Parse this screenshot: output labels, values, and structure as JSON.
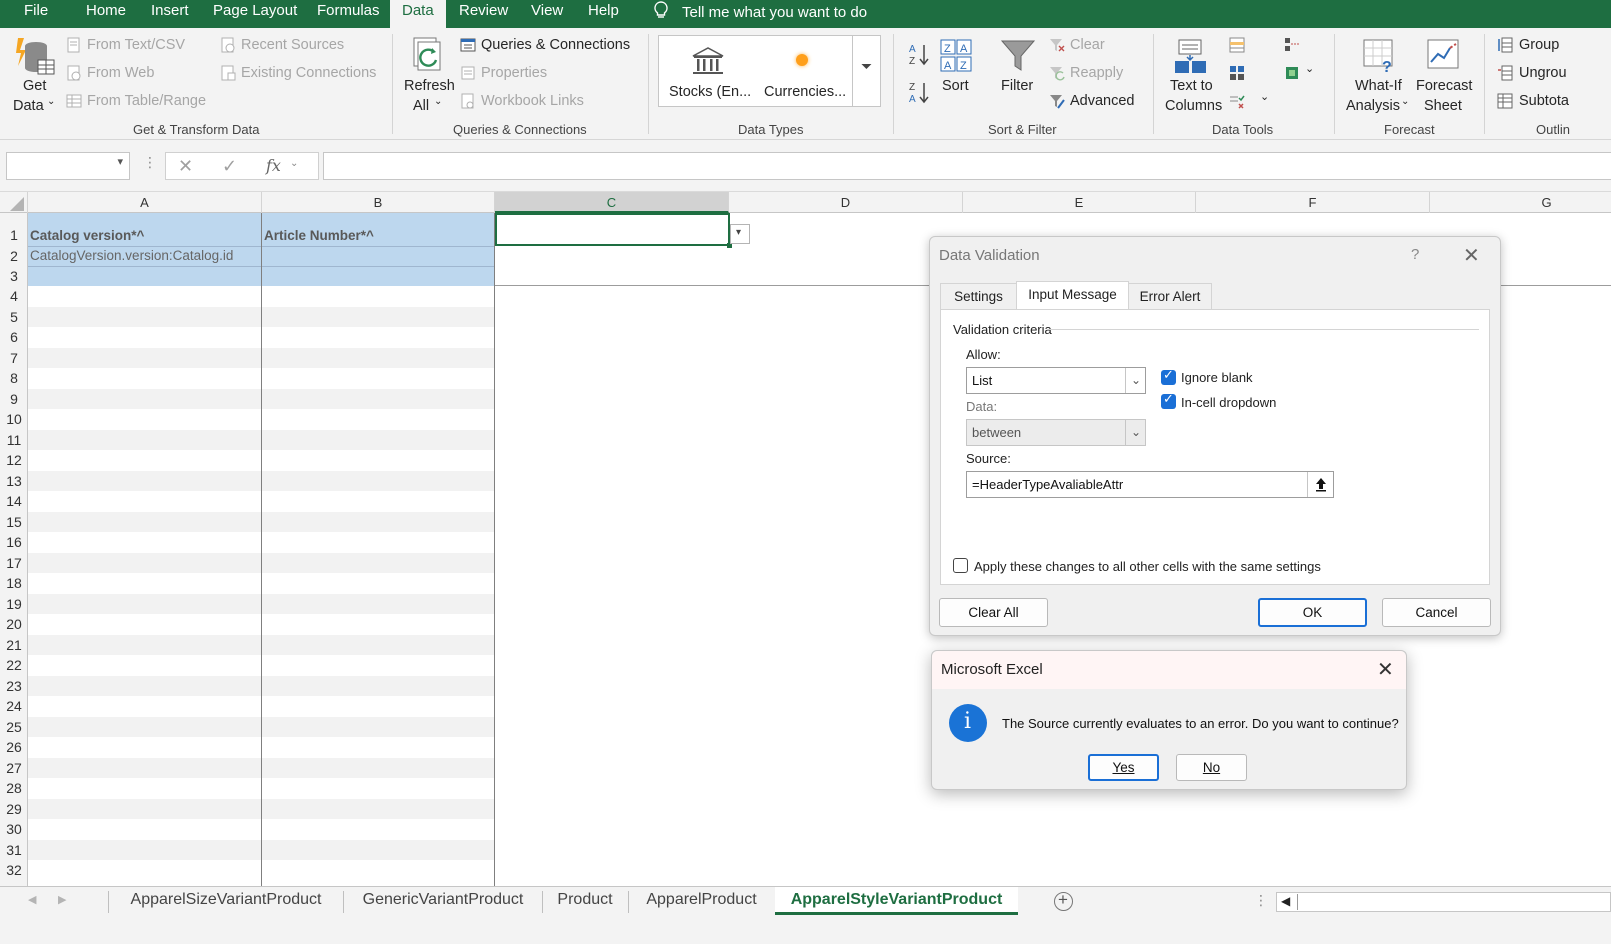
{
  "menu": {
    "tabs": [
      "File",
      "Home",
      "Insert",
      "Page Layout",
      "Formulas",
      "Data",
      "Review",
      "View",
      "Help"
    ],
    "active": "Data",
    "tell_me": "Tell me what you want to do"
  },
  "ribbon": {
    "get_transform": {
      "get_data": [
        "Get",
        "Data"
      ],
      "from_text_csv": "From Text/CSV",
      "from_web": "From Web",
      "from_table_range": "From Table/Range",
      "recent_sources": "Recent Sources",
      "existing_connections": "Existing Connections",
      "label": "Get & Transform Data"
    },
    "queries": {
      "refresh_all": [
        "Refresh",
        "All"
      ],
      "queries_connections": "Queries & Connections",
      "properties": "Properties",
      "workbook_links": "Workbook Links",
      "label": "Queries & Connections"
    },
    "data_types": {
      "stocks": "Stocks (En...",
      "currencies": "Currencies...",
      "label": "Data Types"
    },
    "sort_filter": {
      "sort": "Sort",
      "filter": "Filter",
      "clear": "Clear",
      "reapply": "Reapply",
      "advanced": "Advanced",
      "label": "Sort & Filter"
    },
    "data_tools": {
      "text_to_columns": [
        "Text to",
        "Columns"
      ],
      "label": "Data Tools"
    },
    "forecast": {
      "what_if": [
        "What-If",
        "Analysis"
      ],
      "forecast_sheet": [
        "Forecast",
        "Sheet"
      ],
      "label": "Forecast"
    },
    "outline": {
      "group": "Group",
      "ungroup": "Ungrou",
      "subtotal": "Subtota",
      "label": "Outlin"
    }
  },
  "formula_bar": {
    "name_box": "",
    "formula": "",
    "fx": "fx"
  },
  "grid": {
    "columns": [
      "A",
      "B",
      "C",
      "D",
      "E",
      "F",
      "G"
    ],
    "selected_column": "C",
    "rows": [
      "1",
      "2",
      "3",
      "4",
      "5",
      "6",
      "7",
      "8",
      "9",
      "10",
      "11",
      "12",
      "13",
      "14",
      "15",
      "16",
      "17",
      "18",
      "19",
      "20",
      "21",
      "22",
      "23",
      "24",
      "25",
      "26",
      "27",
      "28",
      "29",
      "30",
      "31",
      "32"
    ],
    "cells": {
      "A1": "Catalog version*^",
      "B1": "Article Number*^",
      "A2": "CatalogVersion.version:Catalog.id"
    }
  },
  "sheets": {
    "tabs": [
      "ApparelSizeVariantProduct",
      "GenericVariantProduct",
      "Product",
      "ApparelProduct",
      "ApparelStyleVariantProduct"
    ],
    "active": "ApparelStyleVariantProduct"
  },
  "data_validation": {
    "title": "Data Validation",
    "help": "?",
    "tabs": [
      "Settings",
      "Input Message",
      "Error Alert"
    ],
    "active_tab": "Input Message",
    "section": "Validation criteria",
    "allow_label": "Allow:",
    "allow_value": "List",
    "data_label": "Data:",
    "data_value": "between",
    "ignore_blank": "Ignore blank",
    "ignore_blank_checked": true,
    "in_cell_dropdown": "In-cell dropdown",
    "in_cell_dropdown_checked": true,
    "source_label": "Source:",
    "source_value": "=HeaderTypeAvaliableAttr",
    "apply_all": "Apply these changes to all other cells with the same settings",
    "apply_all_checked": false,
    "clear_all": "Clear All",
    "ok": "OK",
    "cancel": "Cancel"
  },
  "message_box": {
    "title": "Microsoft Excel",
    "message": "The Source currently evaluates to an error. Do you want to continue?",
    "yes": "Yes",
    "no": "No",
    "icon": "info-icon"
  },
  "colors": {
    "excel_green": "#1e6e41",
    "header_fill": "#bdd7ee",
    "checkbox_blue": "#1a6fd6",
    "ribbon_bg": "#f3f3f3"
  }
}
